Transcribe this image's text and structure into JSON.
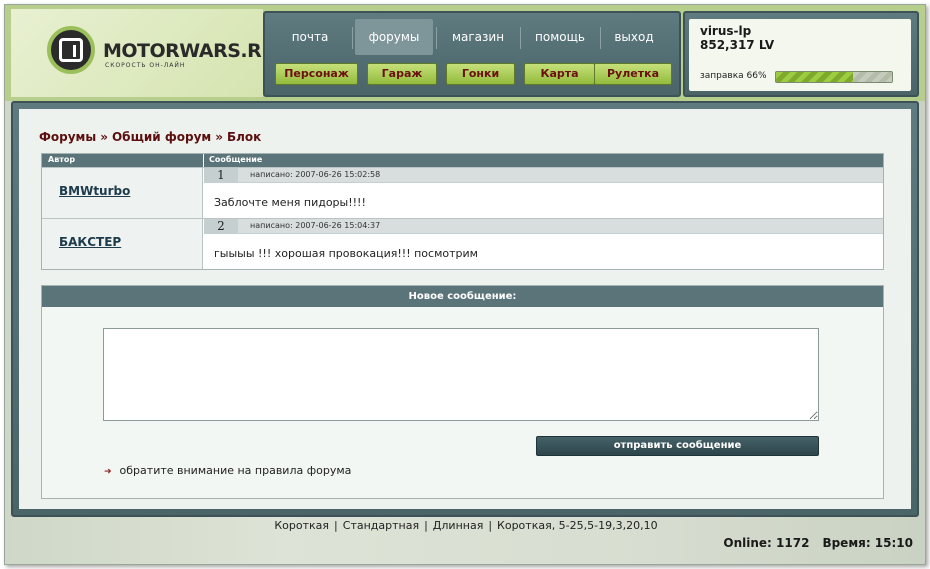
{
  "logo": {
    "title": "MOTORWARS.RU",
    "tagline": "СКОРОСТЬ ОН-ЛАЙН"
  },
  "nav": {
    "tabs": [
      {
        "label": "почта"
      },
      {
        "label": "форумы"
      },
      {
        "label": "магазин"
      },
      {
        "label": "помощь"
      },
      {
        "label": "выход"
      }
    ],
    "active_tab": "форумы",
    "sub": [
      {
        "label": "Персонаж"
      },
      {
        "label": "Гараж"
      },
      {
        "label": "Гонки"
      },
      {
        "label": "Карта"
      },
      {
        "label": "Рулетка"
      }
    ]
  },
  "user": {
    "name": "virus-lp",
    "money": "852,317 LV",
    "fuel_label": "заправка 66%",
    "fuel_fraction": 0.66
  },
  "breadcrumb": {
    "items": [
      "Форумы",
      "Общий форум",
      "Блок"
    ],
    "separator": "»"
  },
  "posts": {
    "col_author": "Автор",
    "col_message": "Сообщение",
    "rows": [
      {
        "num": "1",
        "date": "написано: 2007-06-26 15:02:58",
        "author": "BMWturbo",
        "text": "Заблочте меня пидоры!!!!"
      },
      {
        "num": "2",
        "date": "написано: 2007-06-26 15:04:37",
        "author": "БАКСТЕР",
        "text": "гыыыы !!! хорошая провокация!!! посмотрим"
      }
    ]
  },
  "new_message": {
    "header": "Новое сообщение:",
    "textarea_value": "",
    "send_label": "отправить сообщение",
    "rules_text": "обратите внимание на правила форума"
  },
  "footer": {
    "links": [
      "Короткая",
      "Стандартная",
      "Длинная",
      "Короткая, 5-25,5-19,3,20,10"
    ],
    "separator": "|",
    "online": "Online: 1172",
    "time": "Время: 15:10"
  },
  "colors": {
    "header_green": "#b7cf8c",
    "panel_slate": "#4a6468",
    "button_green": "#93bb3c",
    "breadcrumb_red": "#5b0f0f"
  }
}
